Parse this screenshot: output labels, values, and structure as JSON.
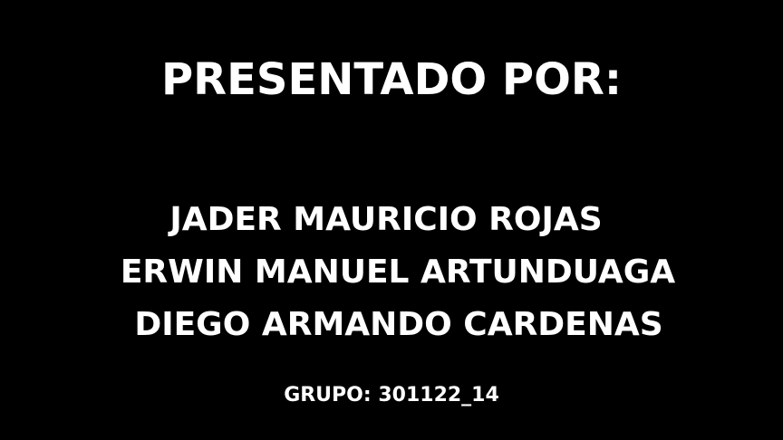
{
  "slide": {
    "background_color": "#000000",
    "text_color": "#ffffff",
    "title": "PRESENTADO POR:",
    "names": [
      "JADER MAURICIO ROJAS",
      "ERWIN MANUEL ARTUNDUAGA",
      "DIEGO ARMANDO CARDENAS"
    ],
    "group": "GRUPO: 301122_14"
  }
}
